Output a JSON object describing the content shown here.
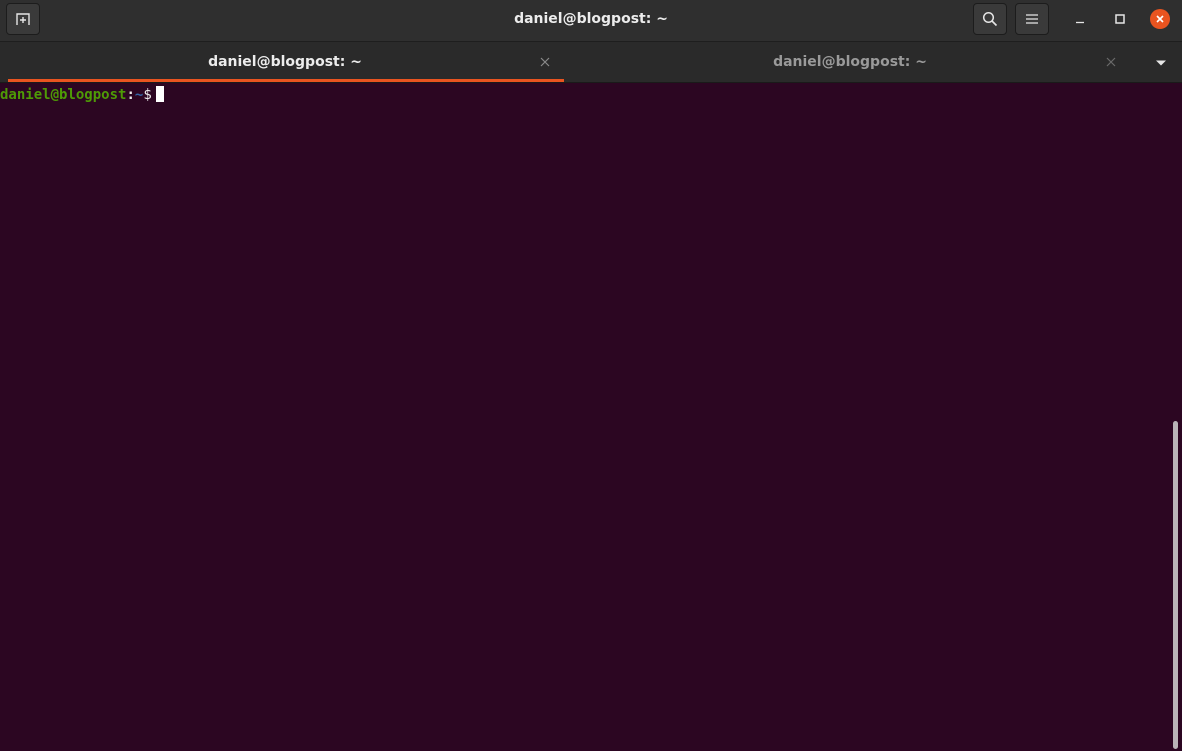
{
  "window": {
    "title": "daniel@blogpost: ~"
  },
  "headerbar": {
    "new_tab_icon": "new-tab-icon",
    "search_icon": "search-icon",
    "menu_icon": "hamburger-menu-icon"
  },
  "controls": {
    "minimize_icon": "minimize-icon",
    "maximize_icon": "maximize-icon",
    "close_icon": "close-icon",
    "close_color": "#e95420"
  },
  "tabs": [
    {
      "label": "daniel@blogpost: ~",
      "active": true
    },
    {
      "label": "daniel@blogpost: ~",
      "active": false
    }
  ],
  "terminal": {
    "background": "#2c0622",
    "prompt": {
      "user_host": "daniel@blogpost",
      "separator": ":",
      "path": "~",
      "symbol": "$"
    }
  },
  "colors": {
    "accent": "#e95420",
    "prompt_user": "#4e9a06",
    "prompt_path": "#3465a4"
  }
}
